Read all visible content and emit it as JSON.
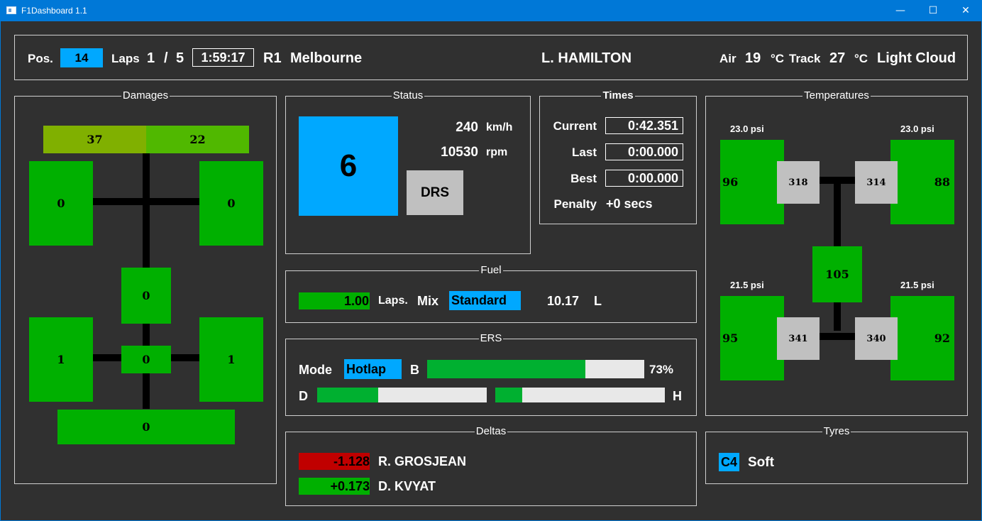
{
  "window": {
    "title": "F1Dashboard 1.1",
    "minimize": "—",
    "maximize": "☐",
    "close": "✕"
  },
  "header": {
    "pos_label": "Pos.",
    "position": "14",
    "laps_label": "Laps",
    "lap_current": "1",
    "lap_sep": "/",
    "lap_total": "5",
    "session_time": "1:59:17",
    "round": "R1",
    "track": "Melbourne",
    "driver": "L. HAMILTON",
    "air_label": "Air",
    "air_temp": "19",
    "air_unit": "°C",
    "track_label": "Track",
    "track_temp": "27",
    "track_unit": "°C",
    "weather": "Light Cloud"
  },
  "damages": {
    "title": "Damages",
    "front_wing_left": "37",
    "front_wing_right": "22",
    "front_left": "0",
    "front_right": "0",
    "body": "0",
    "rear_left": "1",
    "center": "0",
    "rear_right": "1",
    "rear_wing": "0",
    "colors": {
      "front_wing_left": "#80b000",
      "front_wing_right": "#50b800",
      "ok": "#00b000"
    }
  },
  "status": {
    "title": "Status",
    "gear": "6",
    "speed": "240",
    "speed_unit": "km/h",
    "rpm": "10530",
    "rpm_unit": "rpm",
    "drs_label": "DRS"
  },
  "times": {
    "title": "Times",
    "current_label": "Current",
    "current": "0:42.351",
    "last_label": "Last",
    "last": "0:00.000",
    "best_label": "Best",
    "best": "0:00.000",
    "penalty_label": "Penalty",
    "penalty": "+0 secs"
  },
  "temperatures": {
    "title": "Temperatures",
    "fl": {
      "psi": "23.0 psi",
      "tyre": "96",
      "brake": "318"
    },
    "fr": {
      "psi": "23.0 psi",
      "tyre": "88",
      "brake": "314"
    },
    "rl": {
      "psi": "21.5 psi",
      "tyre": "95",
      "brake": "341"
    },
    "rr": {
      "psi": "21.5 psi",
      "tyre": "92",
      "brake": "340"
    },
    "engine": "105"
  },
  "fuel": {
    "title": "Fuel",
    "laps_value": "1.00",
    "laps_label": "Laps.",
    "mix_label": "Mix",
    "mix": "Standard",
    "liters": "10.17",
    "liters_unit": "L"
  },
  "ers": {
    "title": "ERS",
    "mode_label": "Mode",
    "mode": "Hotlap",
    "battery_label": "B",
    "battery_fraction": 0.73,
    "battery_text": "73%",
    "deployed_label": "D",
    "deployed_fraction": 0.36,
    "harvested_label": "H",
    "harvested_fraction": 0.16
  },
  "deltas": {
    "title": "Deltas",
    "rows": [
      {
        "delta": "-1.128",
        "driver": "R. GROSJEAN",
        "color": "#c00000"
      },
      {
        "delta": "+0.173",
        "driver": "D. KVYAT",
        "color": "#00b000"
      }
    ]
  },
  "tyres": {
    "title": "Tyres",
    "compound": "C4",
    "name": "Soft"
  }
}
